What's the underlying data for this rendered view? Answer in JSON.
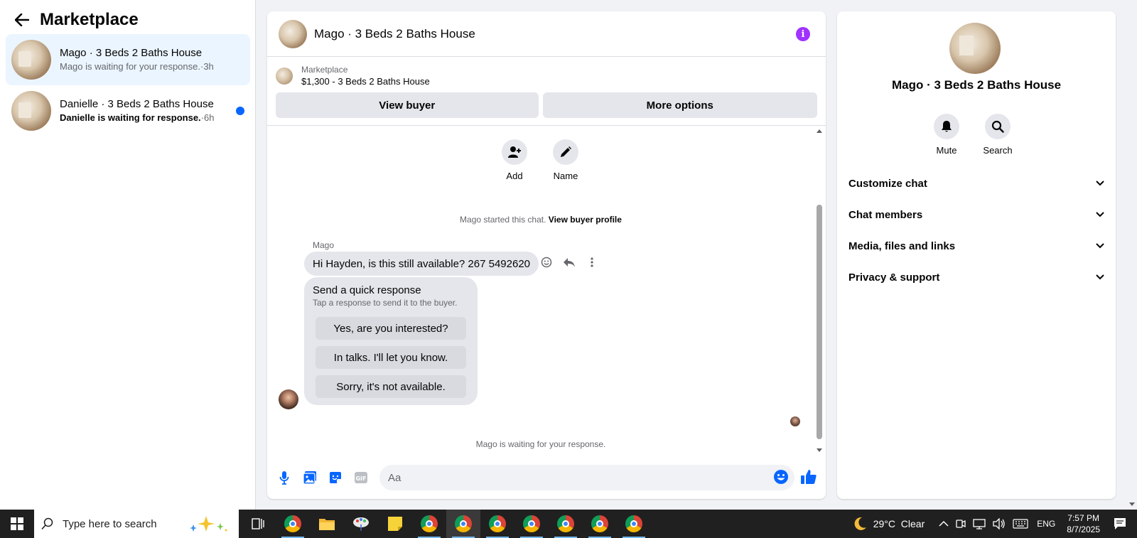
{
  "sidebar": {
    "title": "Marketplace",
    "conversations": [
      {
        "name": "Mago · 3 Beds 2 Baths House",
        "preview": "Mago is waiting for your response.",
        "time": "·3h",
        "active": true,
        "unread": false
      },
      {
        "name": "Danielle · 3 Beds 2 Baths House",
        "preview": "Danielle is waiting for response.",
        "time": "·6h",
        "active": false,
        "unread": true
      }
    ]
  },
  "chat": {
    "title": "Mago · 3 Beds 2 Baths House",
    "listing": {
      "label": "Marketplace",
      "price_title": "$1,300 - 3 Beds 2 Baths House",
      "view_buyer": "View buyer",
      "more_options": "More options"
    },
    "actions": {
      "add": "Add",
      "name": "Name"
    },
    "started_text": "Mago started this chat.",
    "view_profile": "View buyer profile",
    "sender": "Mago",
    "message": "Hi Hayden, is this still available? 267 5492620",
    "quick_response": {
      "title": "Send a quick response",
      "subtitle": "Tap a response to send it to the buyer.",
      "options": [
        "Yes, are you interested?",
        "In talks. I'll let you know.",
        "Sorry, it's not available."
      ]
    },
    "waiting_text": "Mago is waiting for your response.",
    "composer_placeholder": "Aa"
  },
  "right_panel": {
    "name": "Mago · 3 Beds 2 Baths House",
    "mute": "Mute",
    "search": "Search",
    "sections": [
      "Customize chat",
      "Chat members",
      "Media, files and links",
      "Privacy & support"
    ]
  },
  "taskbar": {
    "search_placeholder": "Type here to search",
    "temperature": "29°C",
    "condition": "Clear",
    "language": "ENG",
    "time": "7:57 PM",
    "date": "8/7/2025"
  },
  "colors": {
    "accent": "#0866ff",
    "active_bg": "#ebf5ff",
    "info": "#a033ff"
  }
}
